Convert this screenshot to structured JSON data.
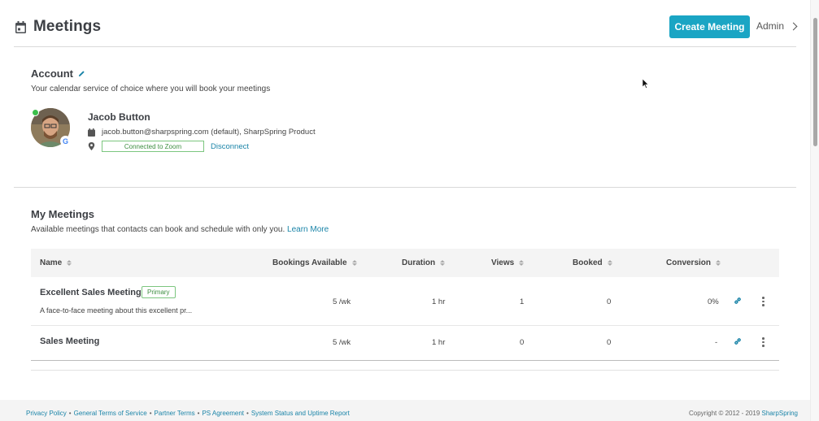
{
  "header": {
    "title": "Meetings",
    "create_button": "Create Meeting",
    "admin_link": "Admin"
  },
  "account": {
    "title": "Account",
    "subtitle": "Your calendar service of choice where you will book your meetings",
    "profile": {
      "name": "Jacob Button",
      "email_line": "jacob.button@sharpspring.com (default), SharpSpring Product",
      "zoom_status": "Connected to Zoom",
      "disconnect": "Disconnect",
      "google_badge": "G"
    }
  },
  "my_meetings": {
    "title": "My Meetings",
    "subtitle": "Available meetings that contacts can book and schedule with only you.",
    "learn_more": "Learn More",
    "columns": [
      "Name",
      "Bookings Available",
      "Duration",
      "Views",
      "Booked",
      "Conversion"
    ],
    "rows": [
      {
        "name": "Excellent Sales Meeting",
        "badge": "Primary",
        "description": "A face-to-face meeting about this excellent pr...",
        "bookings": "5 /wk",
        "duration": "1 hr",
        "views": "1",
        "booked": "0",
        "conversion": "0%"
      },
      {
        "name": "Sales Meeting",
        "badge": "",
        "description": "",
        "bookings": "5 /wk",
        "duration": "1 hr",
        "views": "0",
        "booked": "0",
        "conversion": "-"
      }
    ]
  },
  "footer": {
    "links": [
      "Privacy Policy",
      "General Terms of Service",
      "Partner Terms",
      "PS Agreement",
      "System Status and Uptime Report"
    ],
    "separator": "•",
    "copyright": "Copyright © 2012 - 2019",
    "brand": "SharpSpring"
  },
  "colors": {
    "accent": "#1aa5c4",
    "link": "#1a84a8",
    "success": "#3e8e41",
    "online": "#3cc04c"
  },
  "icons": {
    "title": "calendar-icon",
    "edit": "pencil-icon",
    "email": "calendar-small-icon",
    "location": "map-pin-icon",
    "row_link": "link-icon",
    "row_menu": "kebab-menu-icon"
  }
}
